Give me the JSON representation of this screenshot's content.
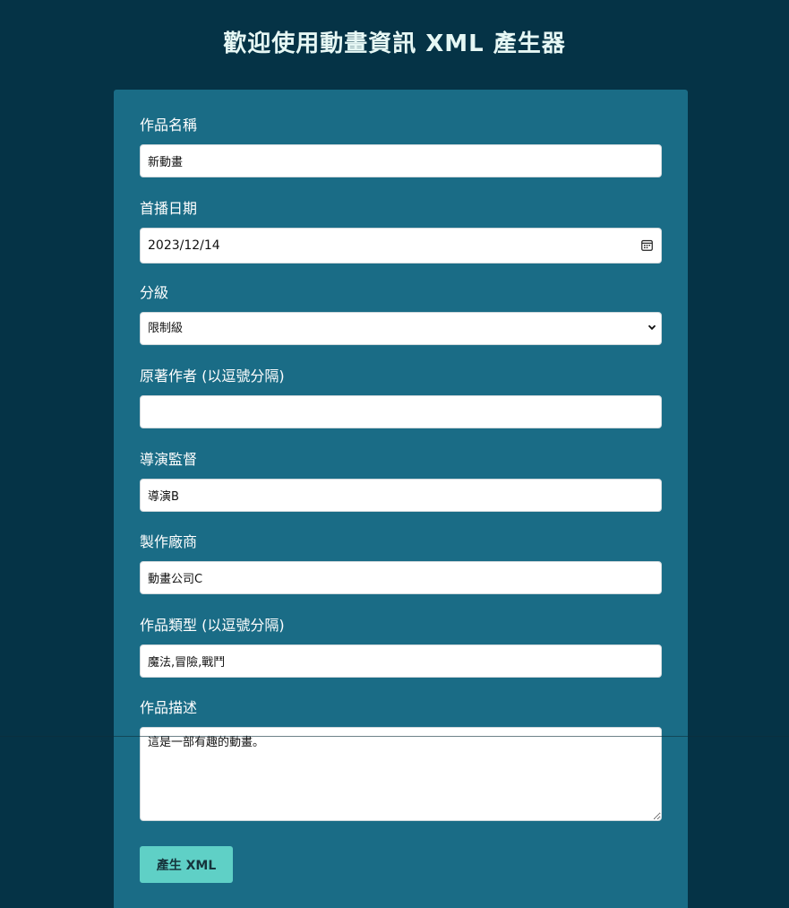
{
  "header": {
    "title": "歡迎使用動畫資訊 XML 產生器"
  },
  "form": {
    "fields": {
      "title": {
        "label": "作品名稱",
        "value": "新動畫"
      },
      "premiere_date": {
        "label": "首播日期",
        "value": "2023/12/14"
      },
      "rating": {
        "label": "分級",
        "value": "限制級",
        "options": [
          "限制級"
        ]
      },
      "original_author": {
        "label": "原著作者 (以逗號分隔)",
        "value": ""
      },
      "director": {
        "label": "導演監督",
        "value": "導演B"
      },
      "studio": {
        "label": "製作廠商",
        "value": "動畫公司C"
      },
      "genres": {
        "label": "作品類型 (以逗號分隔)",
        "value": "魔法,冒險,戰鬥"
      },
      "description": {
        "label": "作品描述",
        "value": "這是一部有趣的動畫。"
      }
    },
    "submit_label": "產生 XML"
  },
  "icons": {
    "calendar": "calendar-icon",
    "chevron": "chevron-down-icon"
  },
  "colors": {
    "background": "#053346",
    "panel": "#1a6c86",
    "button": "#5fd0c6",
    "title_text": "#e6f7f4"
  }
}
